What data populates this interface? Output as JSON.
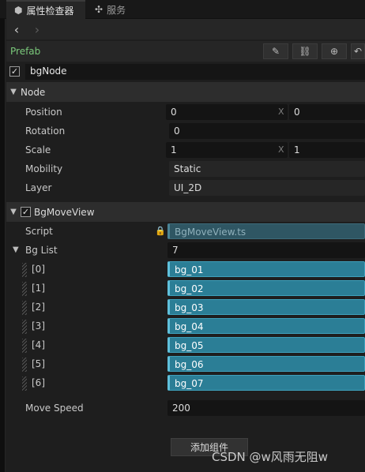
{
  "tabs": [
    {
      "label": "属性检查器",
      "icon": "inspector-icon"
    },
    {
      "label": "服务",
      "icon": "grid-icon"
    }
  ],
  "prefab": {
    "label": "Prefab"
  },
  "node": {
    "name": "bgNode",
    "enabled": true
  },
  "node_section": {
    "title": "Node",
    "position": {
      "label": "Position",
      "x": "0",
      "y": "0"
    },
    "rotation": {
      "label": "Rotation",
      "value": "0"
    },
    "scale": {
      "label": "Scale",
      "x": "1",
      "y": "1"
    },
    "mobility": {
      "label": "Mobility",
      "value": "Static"
    },
    "layer": {
      "label": "Layer",
      "value": "UI_2D"
    },
    "axis_x": "X"
  },
  "component": {
    "title": "BgMoveView",
    "enabled": true,
    "script": {
      "label": "Script",
      "value": "BgMoveView.ts"
    },
    "bg_list": {
      "label": "Bg List",
      "count": "7",
      "items": [
        {
          "index": "[0]",
          "value": "bg_01"
        },
        {
          "index": "[1]",
          "value": "bg_02"
        },
        {
          "index": "[2]",
          "value": "bg_03"
        },
        {
          "index": "[3]",
          "value": "bg_04"
        },
        {
          "index": "[4]",
          "value": "bg_05"
        },
        {
          "index": "[5]",
          "value": "bg_06"
        },
        {
          "index": "[6]",
          "value": "bg_07"
        }
      ]
    },
    "move_speed": {
      "label": "Move Speed",
      "value": "200"
    }
  },
  "add_component": {
    "label": "添加组件"
  },
  "watermark": "CSDN @w风雨无阻w"
}
